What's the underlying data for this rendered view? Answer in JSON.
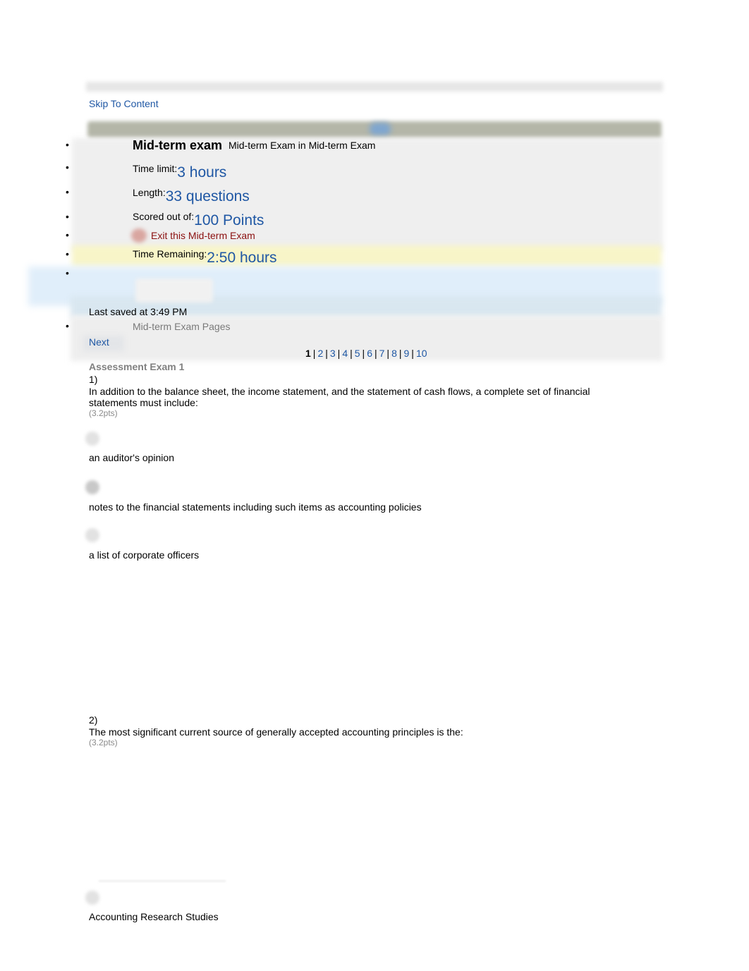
{
  "skip_link": "Skip To Content",
  "header": {
    "title": "Mid-term exam",
    "subtitle": "Mid-term Exam in Mid-term Exam"
  },
  "info": {
    "time_limit": {
      "label": "Time limit:",
      "value": "3 hours"
    },
    "length": {
      "label": "Length:",
      "value": "33 questions"
    },
    "scored": {
      "label": "Scored out of:",
      "value": "100 Points"
    },
    "exit_label": "Exit this Mid-term Exam",
    "time_remaining": {
      "label": "Time Remaining:",
      "value": "2:50 hours"
    }
  },
  "last_saved": "Last saved at 3:49 PM",
  "pages_label": "Mid-term Exam Pages",
  "next_label": "Next",
  "pager": {
    "current": "1",
    "pages": [
      "2",
      "3",
      "4",
      "5",
      "6",
      "7",
      "8",
      "9",
      "10"
    ]
  },
  "section_title": "Assessment Exam 1",
  "questions": [
    {
      "number": "1)",
      "text": "In addition to the balance sheet, the income statement, and the statement of cash flows, a complete set of financial statements must include:",
      "points": "(3.2pts)",
      "choices": [
        {
          "label": "an auditor's opinion",
          "selected": false
        },
        {
          "label": "notes to the financial statements including such items as accounting policies",
          "selected": true
        },
        {
          "label": "a list of corporate officers",
          "selected": false
        }
      ]
    },
    {
      "number": "2)",
      "text": "The most significant current source of generally accepted accounting principles is the:",
      "points": "(3.2pts)",
      "choices": [
        {
          "label": "Accounting Research Studies",
          "selected": false
        }
      ]
    }
  ],
  "colors": {
    "link": "#1f57a4",
    "exit": "#8b1010",
    "muted": "#808080",
    "title_bar": "#b4b6a8",
    "timer_band": "#f8f5c8",
    "saved_band": "#e0eefa"
  }
}
